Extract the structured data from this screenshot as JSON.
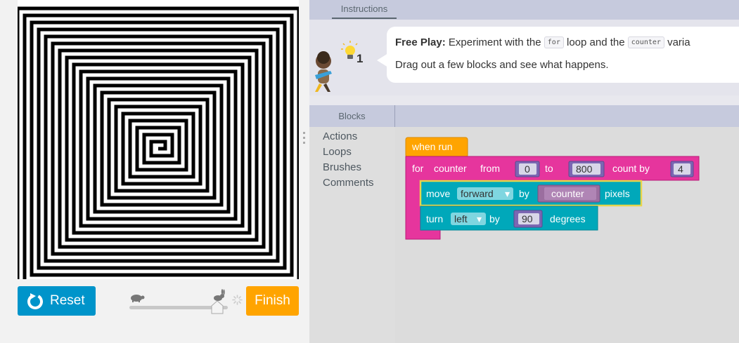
{
  "colors": {
    "reset_button": "#0094ca",
    "finish_button": "#ffa400",
    "when_run_block": "#ffa400",
    "for_block": "#e6359d",
    "move_block": "#00a8ba",
    "variable_block": "#9b6e9f",
    "number_block": "#7b67b3",
    "header_bg": "#c6cadd"
  },
  "visualization": {
    "drawing": "square spiral of black lines on white"
  },
  "controls": {
    "reset_label": "Reset",
    "reset_icon": "reset-arrow-icon",
    "finish_label": "Finish",
    "speed_slow_icon": "turtle-icon",
    "speed_fast_icon": "rabbit-icon",
    "speed_level": 0.85
  },
  "instructions": {
    "tab_label": "Instructions",
    "hint_count": "1",
    "line1_bold": "Free Play:",
    "line1_part1": " Experiment with the ",
    "line1_code1": "for",
    "line1_part2": " loop and the ",
    "line1_code2": "counter",
    "line1_part3": " varia",
    "line2": "Drag out a few blocks and see what happens."
  },
  "blocks_panel": {
    "tab_label": "Blocks",
    "categories": [
      "Actions",
      "Loops",
      "Brushes",
      "Comments"
    ]
  },
  "program": {
    "when_run": "when run",
    "for_label": "for",
    "for_var": "counter",
    "from_label": "from",
    "from_value": "0",
    "to_label": "to",
    "to_value": "800",
    "count_by_label": "count by",
    "count_by_value": "4",
    "move_label": "move",
    "move_direction": "forward",
    "move_by_label": "by",
    "move_var": "counter",
    "move_units": "pixels",
    "turn_label": "turn",
    "turn_direction": "left",
    "turn_by_label": "by",
    "turn_value": "90",
    "turn_units": "degrees"
  }
}
